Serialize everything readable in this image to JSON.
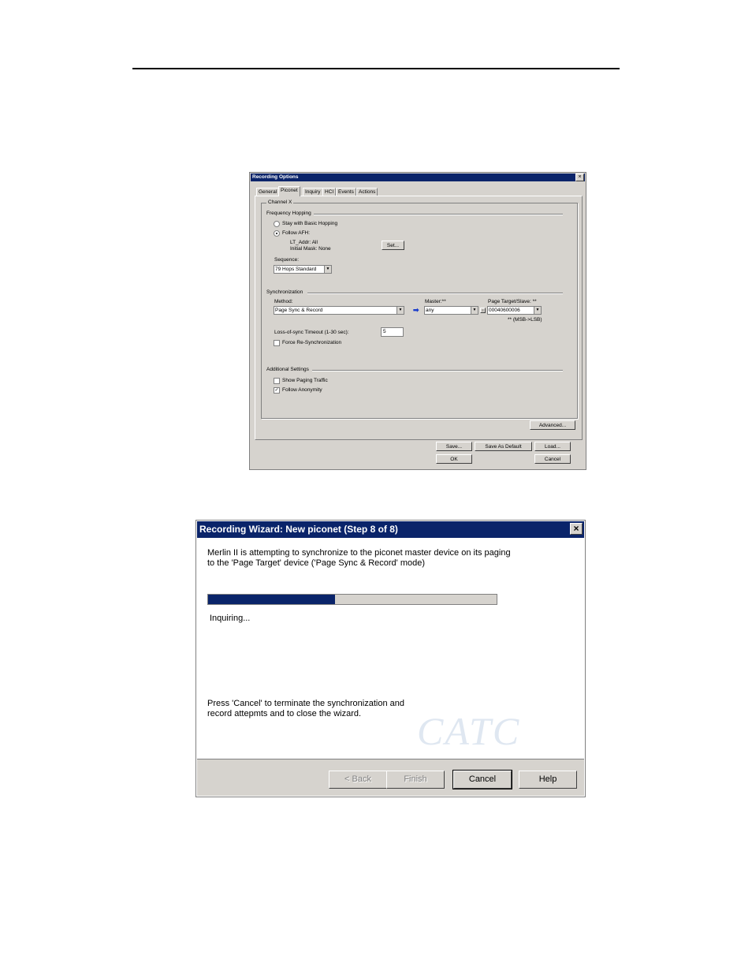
{
  "recording_options": {
    "title": "Recording Options",
    "close_glyph": "×",
    "tabs": [
      "General",
      "Piconet",
      "Inquiry",
      "HCI",
      "Events",
      "Actions"
    ],
    "active_tab": "Piconet",
    "group_label": "Channel X",
    "frequency_hopping": {
      "label": "Frequency Hopping",
      "stay_basic": "Stay with Basic Hopping",
      "follow_afh": "Follow AFH:",
      "lt_addr": "LT_Addr: All",
      "initial_mask": "Initial Mask: None",
      "set_button": "Set...",
      "sequence_label": "Sequence:",
      "sequence_value": "79 Hops Standard"
    },
    "synchronization": {
      "label": "Synchronization",
      "method_label": "Method:",
      "method_value": "Page Sync & Record",
      "master_label": "Master:**",
      "master_value": "any",
      "page_target_label": "Page Target/Slave: **",
      "page_target_value": "00040600006",
      "msb_note": "** (MSB->LSB)",
      "timeout_label": "Loss-of-sync Timeout (1-30 sec):",
      "timeout_value": "5",
      "force_resync": "Force Re-Synchronization"
    },
    "additional": {
      "label": "Additional Settings",
      "show_paging": "Show Paging Traffic",
      "show_paging_checked": false,
      "follow_anonymity": "Follow Anonymity",
      "follow_anonymity_checked": true
    },
    "buttons": {
      "advanced": "Advanced...",
      "save": "Save...",
      "save_default": "Save As Default",
      "load": "Load...",
      "ok": "OK",
      "cancel": "Cancel"
    }
  },
  "wizard": {
    "title": "Recording Wizard: New piconet (Step 8 of 8)",
    "close_glyph": "×",
    "message_line1": "Merlin II  is attempting  to synchronize to the piconet master device on its paging",
    "message_line2": "to the 'Page Target' device ('Page Sync & Record' mode)",
    "progress_percent": 44,
    "status": "Inquiring...",
    "cancel_note_line1": "Press 'Cancel' to terminate the synchronization and",
    "cancel_note_line2": "record attepmts and to close the wizard.",
    "logo_text": "CATC",
    "buttons": {
      "back": "< Back",
      "finish": "Finish",
      "cancel": "Cancel",
      "help": "Help"
    },
    "colors": {
      "title_bar": "#0a246a",
      "progress_fill": "#0a246a",
      "face": "#d6d3ce"
    }
  }
}
